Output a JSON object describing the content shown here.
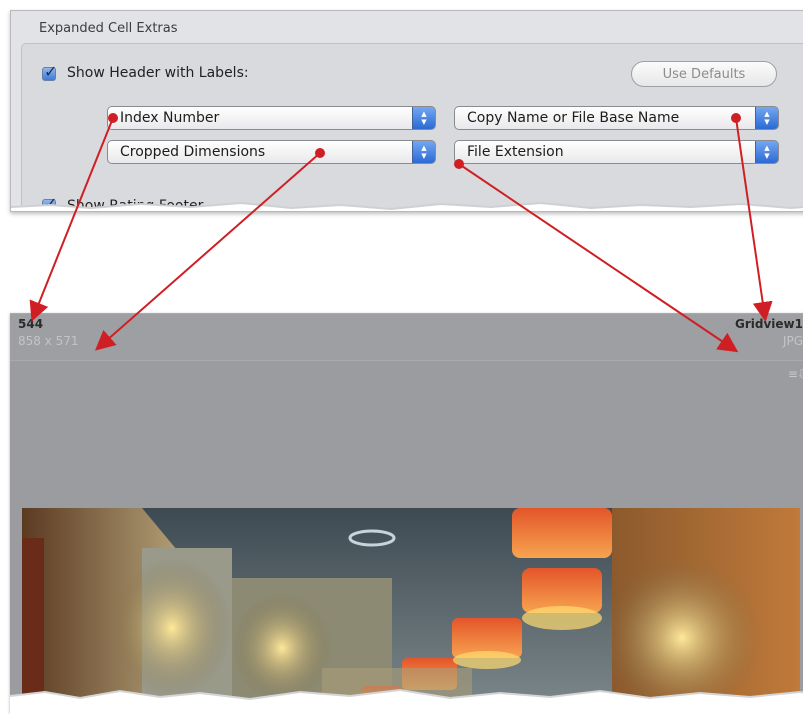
{
  "settings_panel": {
    "section_title": "Expanded Cell Extras",
    "show_header": {
      "checked": true,
      "label": "Show Header with Labels:"
    },
    "use_defaults_label": "Use Defaults",
    "popups": {
      "top_left": "Index Number",
      "top_right": "Copy Name or File Base Name",
      "bottom_left": "Cropped Dimensions",
      "bottom_right": "File Extension"
    },
    "show_rating_footer": {
      "checked": true,
      "label": "Show Rating Footer"
    }
  },
  "cell": {
    "index_number": "544",
    "dimensions": "858 x 571",
    "file_name": "Gridview1",
    "extension": "JPG",
    "badge_icon": "metadata-badge-icon"
  },
  "colors": {
    "arrow": "#cf1f25",
    "panel_bg": "#e2e3e6",
    "cell_bg": "#9b9c9f",
    "popup_accent": "#2a6ad4"
  }
}
